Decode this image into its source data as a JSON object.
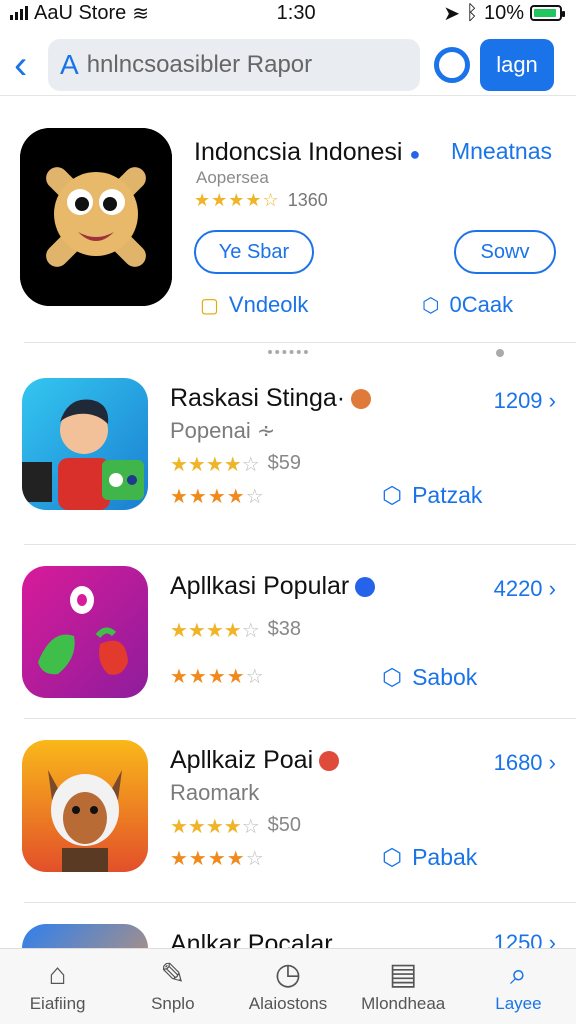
{
  "status_bar": {
    "carrier": "AaU Store",
    "time": "1:30",
    "battery_text": "10%",
    "battery_level": 0.9
  },
  "header": {
    "back_icon": "chevron-left-icon",
    "search_prefix": "A",
    "search_text": "hnlncsoasibler Rapor",
    "settings_icon": "gear-icon",
    "login_label": "lagn"
  },
  "featured": {
    "title": "Indoncsia Indonesi",
    "link_label": "Mneatnas",
    "subtitle": "Aopersea",
    "rating_stars": 3.5,
    "rating_count": "1360",
    "button_left": "Ye Sbar",
    "button_right": "Sowv",
    "action_left": "Vndeolk",
    "action_right": "0Caak"
  },
  "apps": [
    {
      "title": "Raskasi Stinga·",
      "subtitle": "Popenai ∻",
      "rating_text": "$59",
      "count": "1209",
      "action": "Patzak",
      "badge_color": "#e07a3a"
    },
    {
      "title": "Apllkasi Popular",
      "subtitle": "",
      "rating_text": "$38",
      "count": "4220",
      "action": "Sabok",
      "badge_color": "#2563eb"
    },
    {
      "title": "Apllkaiz Poai",
      "subtitle": "Raomark",
      "rating_text": "$50",
      "count": "1680",
      "action": "Pabak",
      "badge_color": "#e04a3a"
    },
    {
      "title": "Anlkar Pocalar",
      "subtitle": "",
      "rating_text": "",
      "count": "1250",
      "action": "",
      "badge_color": ""
    }
  ],
  "tabs": [
    {
      "label": "Eiafiing",
      "icon": "home-icon",
      "active": false
    },
    {
      "label": "Snplo",
      "icon": "pen-icon",
      "active": false
    },
    {
      "label": "Alaiostons",
      "icon": "clock-icon",
      "active": false
    },
    {
      "label": "Mlondheaa",
      "icon": "message-icon",
      "active": false
    },
    {
      "label": "Layee",
      "icon": "search-icon",
      "active": true
    }
  ],
  "colors": {
    "accent": "#1a73e8",
    "star_gold": "#f0b429",
    "star_orange": "#f08a1c"
  }
}
